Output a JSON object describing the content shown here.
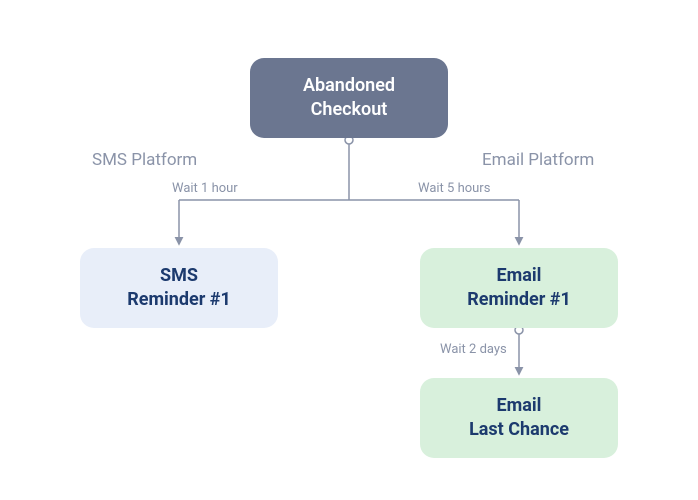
{
  "root": {
    "line1": "Abandoned",
    "line2": "Checkout"
  },
  "platforms": {
    "sms_label": "SMS Platform",
    "email_label": "Email Platform"
  },
  "waits": {
    "w1": "Wait 1 hour",
    "w5": "Wait 5 hours",
    "w2d": "Wait 2 days"
  },
  "sms_node": {
    "line1": "SMS",
    "line2": "Reminder #1"
  },
  "email_node1": {
    "line1": "Email",
    "line2": "Reminder #1"
  },
  "email_node2": {
    "line1": "Email",
    "line2": "Last Chance"
  },
  "colors": {
    "root_bg": "#6b7690",
    "sms_bg": "#e8eef9",
    "email_bg": "#d8f0dc",
    "text_dark": "#1c3a6e",
    "line": "#8a93a8"
  }
}
